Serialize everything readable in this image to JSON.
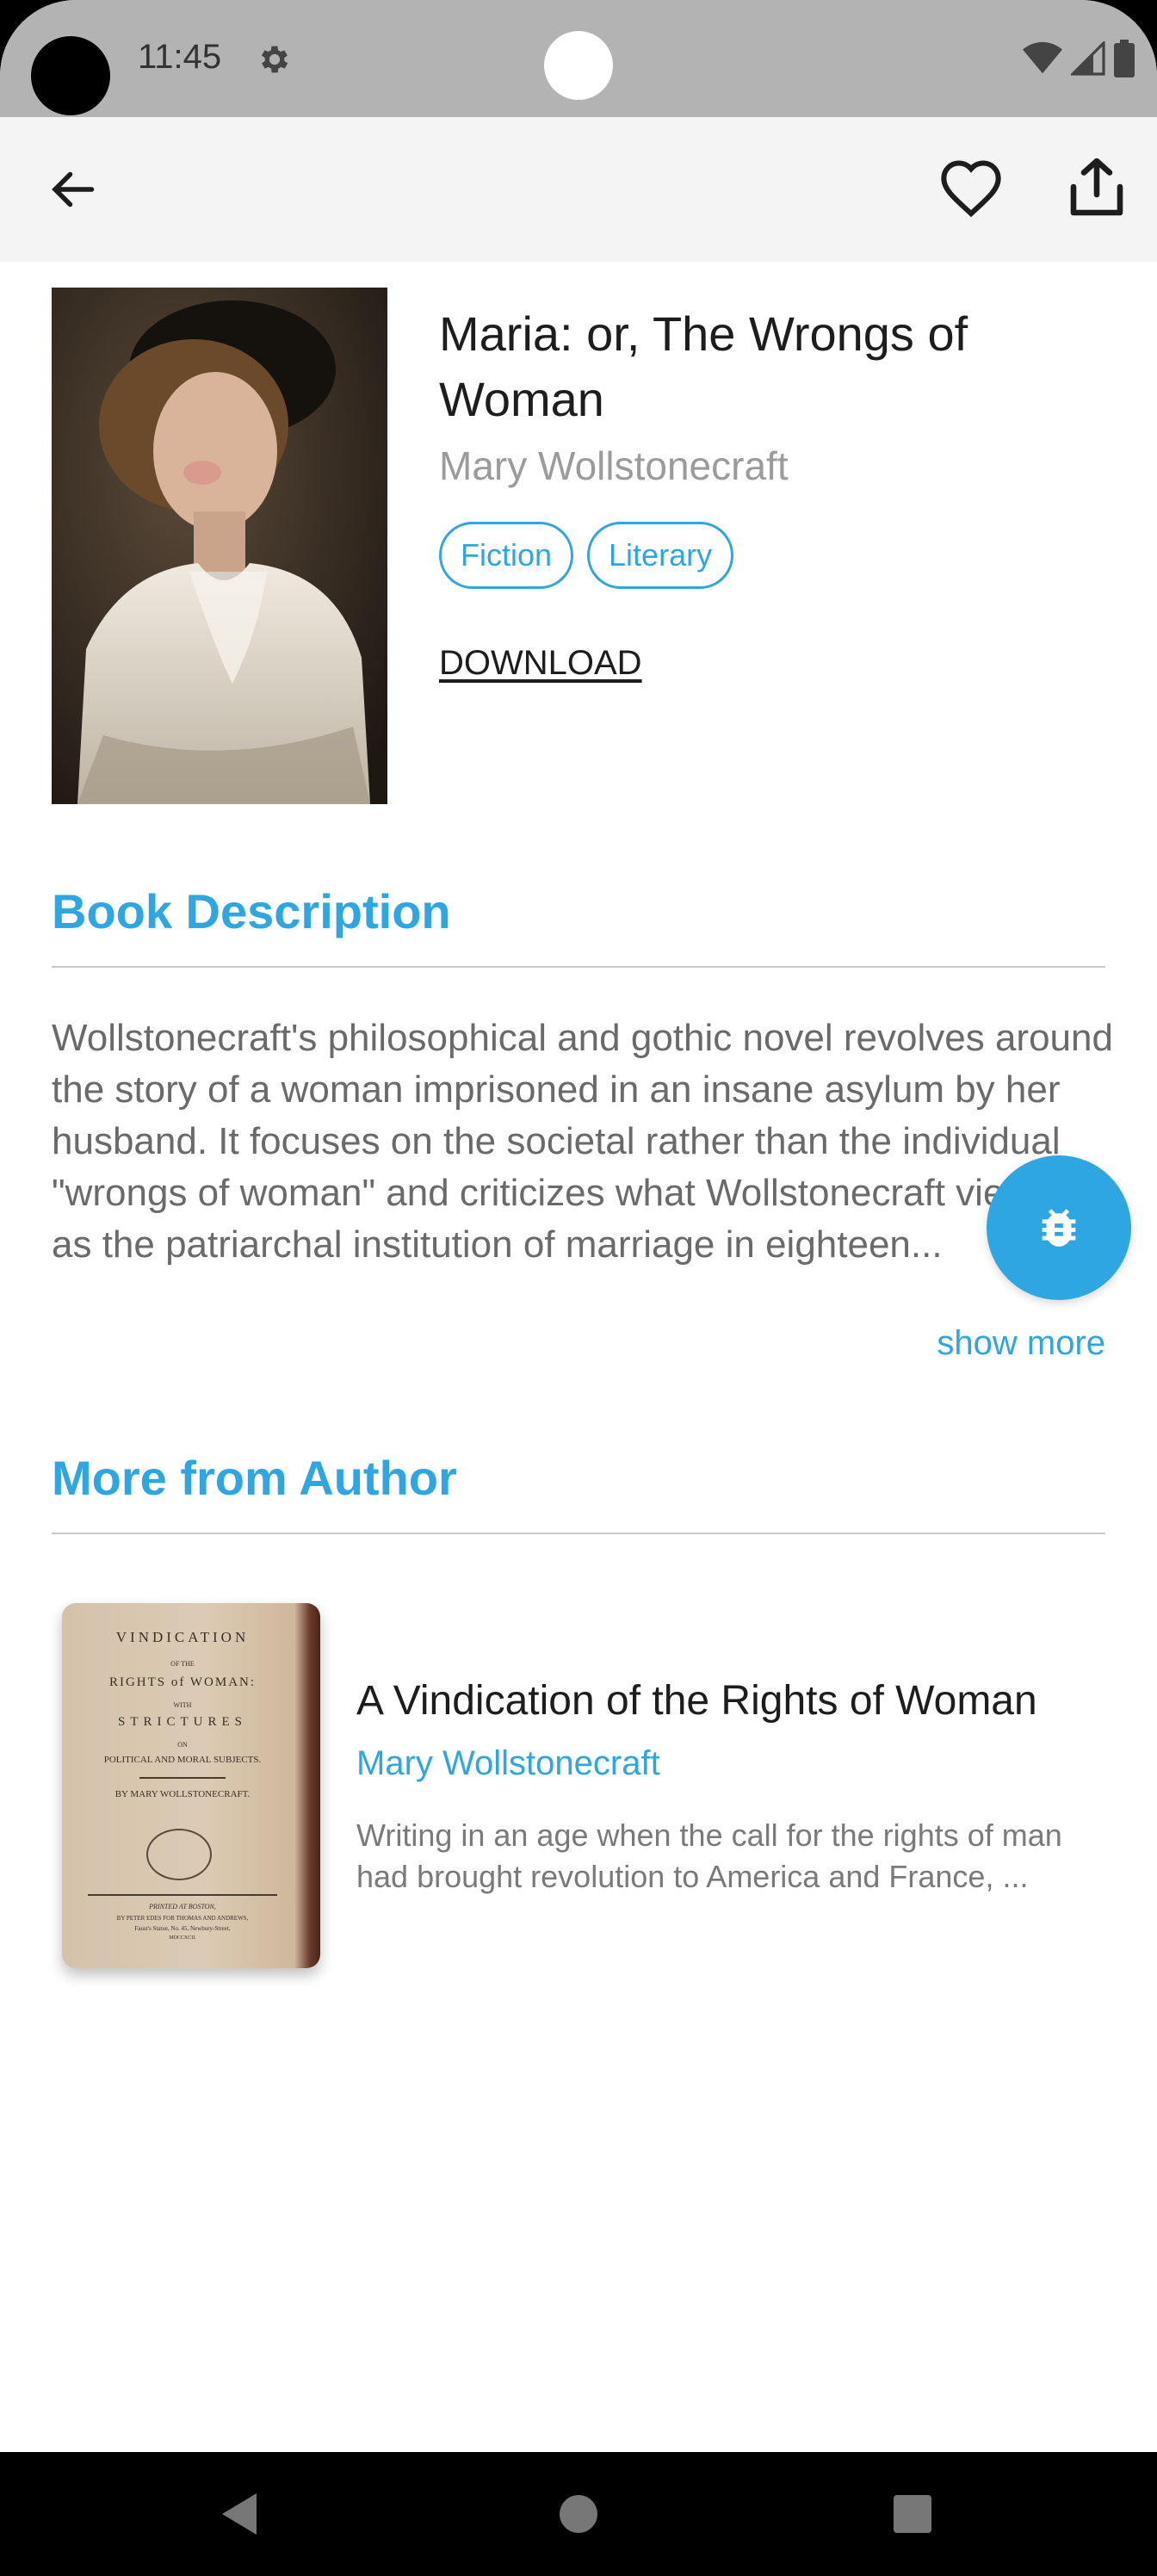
{
  "status_bar": {
    "time": "11:45"
  },
  "icons": {
    "back": "arrow-back-icon",
    "favorite": "heart-outline-icon",
    "share": "share-icon",
    "fab": "bug-icon",
    "settings": "gear-icon",
    "wifi": "wifi-icon",
    "signal": "signal-icon",
    "battery": "battery-icon"
  },
  "book": {
    "title": "Maria: or, The Wrongs of Woman",
    "author": "Mary Wollstonecraft",
    "tags": [
      "Fiction",
      "Literary"
    ],
    "download_label": "DOWNLOAD"
  },
  "description": {
    "heading": "Book Description",
    "text": "Wollstonecraft's philosophical and gothic novel revolves around the story of a woman imprisoned in an insane asylum by her husband. It focuses on the societal rather than the individual \"wrongs of woman\" and criticizes what Wollstonecraft viewed as the patriarchal institution of marriage in eighteen...",
    "show_more": "show more"
  },
  "more_from_author": {
    "heading": "More from Author",
    "items": [
      {
        "title": "A Vindication of the Rights of Woman",
        "author": "Mary Wollstonecraft",
        "excerpt": "Writing in an age when the call for the rights of man had brought revolution to America and France, ...",
        "cover_lines": [
          "VINDICATION",
          "OF THE",
          "RIGHTS of WOMAN:",
          "WITH",
          "STRICTURES",
          "ON",
          "POLITICAL AND MORAL SUBJECTS.",
          "BY MARY WOLLSTONECRAFT.",
          "PRINTED AT BOSTON,",
          "BY PETER EDES FOR THOMAS AND ANDREWS,",
          "Faust's Statue, No. 45, Newbury-Street,",
          "MDCCXCII."
        ]
      }
    ]
  },
  "colors": {
    "accent": "#2ea6e1",
    "status_bar": "#b3b3b3",
    "app_bar": "#f4f4f4",
    "text_primary": "#1d1d1d",
    "text_secondary": "#9b9b9b"
  }
}
